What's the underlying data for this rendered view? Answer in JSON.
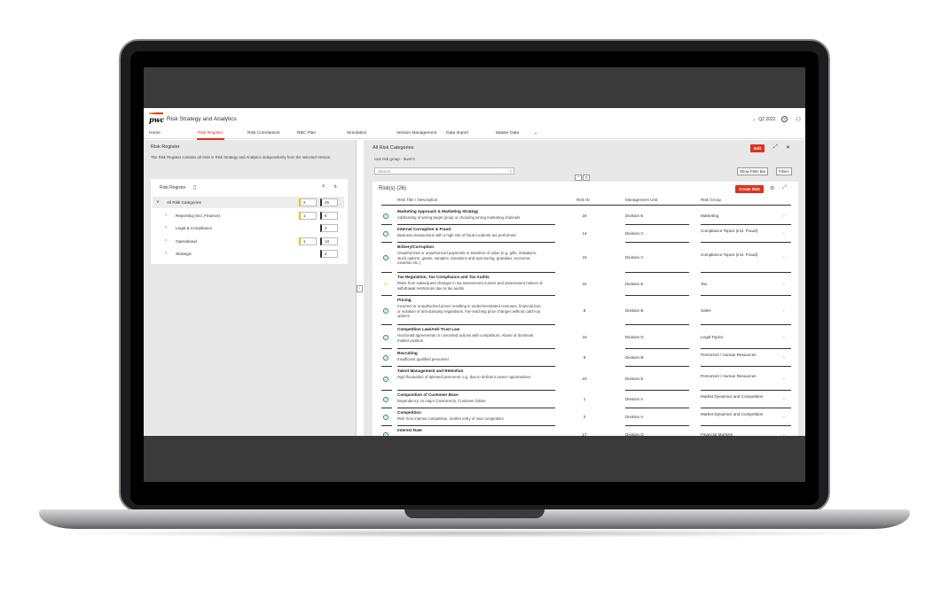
{
  "app": {
    "logo": "pwc",
    "title": "Risk Strategy and Analytics",
    "period": "Q2 2022",
    "help": "?"
  },
  "nav": [
    "Home",
    "Risk Register",
    "Risk Correlations",
    "RBC Plan",
    "Simulation",
    "Version Management",
    "Data Import",
    "Master Data"
  ],
  "left": {
    "title": "Risk Register",
    "description": "The Risk Register contains all risks in Risk Strategy and Analytics independently from the selected Version.",
    "tree_header": "Risk Register",
    "categories": [
      {
        "label": "All Risk Categories",
        "warn": "2",
        "total": "26"
      },
      {
        "label": "Reporting (incl. Finance)",
        "warn": "1",
        "total": "6"
      },
      {
        "label": "Legal & Compliance",
        "warn": "",
        "total": "3"
      },
      {
        "label": "Operational",
        "warn": "1",
        "total": "13"
      },
      {
        "label": "Strategic",
        "warn": "",
        "total": "4"
      }
    ]
  },
  "right": {
    "title": "All Risk Categories",
    "edit": "Edit",
    "breadcrumb": "root risk group - level 0",
    "search_placeholder": "Search",
    "show_filter_bar": "Show Filter Bar",
    "filters": "Filters",
    "count_label": "Risk(s) (26)",
    "create": "Create Risk",
    "columns": [
      "Risk Title / Description",
      "Risk ID",
      "Management Unit",
      "Risk Group"
    ],
    "rows": [
      {
        "status": "ok",
        "title": "Marketing Approach & Marketing Strategy",
        "desc": "Addressing of wrong target group or choosing wrong marketing channels",
        "id": "24",
        "unit": "Division E",
        "group": "Marketing"
      },
      {
        "status": "ok",
        "title": "Internal Corruption & Fraud",
        "desc": "Business transactions with a high risk of fraud incidents are performed",
        "id": "14",
        "unit": "Division C",
        "group": "Compliance Topics (incl. Fraud)"
      },
      {
        "status": "ok",
        "title": "Bribery/Corruption",
        "desc": "Unauthorized or unauthorized payments or transfers of value (e.g. gifts, invitations, stock options, grants, samples, donations and sponsoring, gratuities, economic extortion etc.)",
        "id": "15",
        "unit": "Division C",
        "group": "Compliance Topics (incl. Fraud)"
      },
      {
        "status": "warn",
        "title": "Tax Regulation, Tax Compliance and Tax Audits",
        "desc": "Risks from subsequent changes in tax assessment notices and assessment notices of withdrawal restrictions due to tax audits",
        "id": "22",
        "unit": "Division E",
        "group": "Tax"
      },
      {
        "status": "ok",
        "title": "Pricing",
        "desc": "Incorrect or unauthorized prices resulting in under/overstated revenues, financial loss or violation of anti-dumping regulations, Far-reaching price changes without catch-up options",
        "id": "8",
        "unit": "Division B",
        "group": "Sales"
      },
      {
        "status": "ok",
        "title": "Competition Law/Anti-Trust Law",
        "desc": "Horizontal agreements or concerted actions with competitors; Abuse of dominant market position",
        "id": "16",
        "unit": "Division D",
        "group": "Legal Topics"
      },
      {
        "status": "ok",
        "title": "Recruiting",
        "desc": "Insufficient qualified personnel",
        "id": "9",
        "unit": "Division B",
        "group": "Personnel / Human Resources"
      },
      {
        "status": "ok",
        "title": "Talent Management and Retention",
        "desc": "High fluctuation of talented personnel, e.g. due to deficient career opportunities",
        "id": "23",
        "unit": "Division E",
        "group": "Personnel / Human Resources"
      },
      {
        "status": "ok",
        "title": "Composition of Customer Base",
        "desc": "Dependency on major (customer)s, Customer failure",
        "id": "1",
        "unit": "Division A",
        "group": "Market Dynamics and Competition"
      },
      {
        "status": "ok",
        "title": "Competition",
        "desc": "Risk from intense competition, market entry of new competitors",
        "id": "2",
        "unit": "Division A",
        "group": "Market Dynamics and Competition"
      },
      {
        "status": "ok",
        "title": "Interest Rate",
        "desc": "",
        "id": "17",
        "unit": "Division D",
        "group": "Financial Markets"
      }
    ]
  }
}
